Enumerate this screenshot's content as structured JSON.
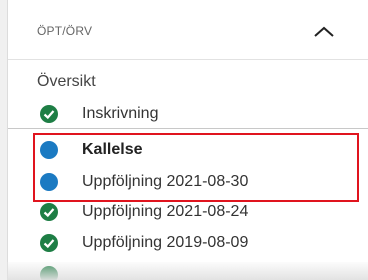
{
  "section": {
    "title": "ÖPT/ÖRV",
    "collapse_icon": "chevron-up-icon"
  },
  "overview_label": "Översikt",
  "colors": {
    "complete": "#1e7e45",
    "active": "#1b7ac2",
    "highlight": "#e0141e"
  },
  "items": [
    {
      "label": "Inskrivning",
      "status": "complete",
      "bold": false
    },
    {
      "label": "Kallelse",
      "status": "active",
      "bold": true
    },
    {
      "label": "Uppföljning 2021-08-30",
      "status": "active",
      "bold": false
    },
    {
      "label": "Uppföljning 2021-08-24",
      "status": "complete",
      "bold": false
    },
    {
      "label": "Uppföljning 2019-08-09",
      "status": "complete",
      "bold": false
    }
  ]
}
